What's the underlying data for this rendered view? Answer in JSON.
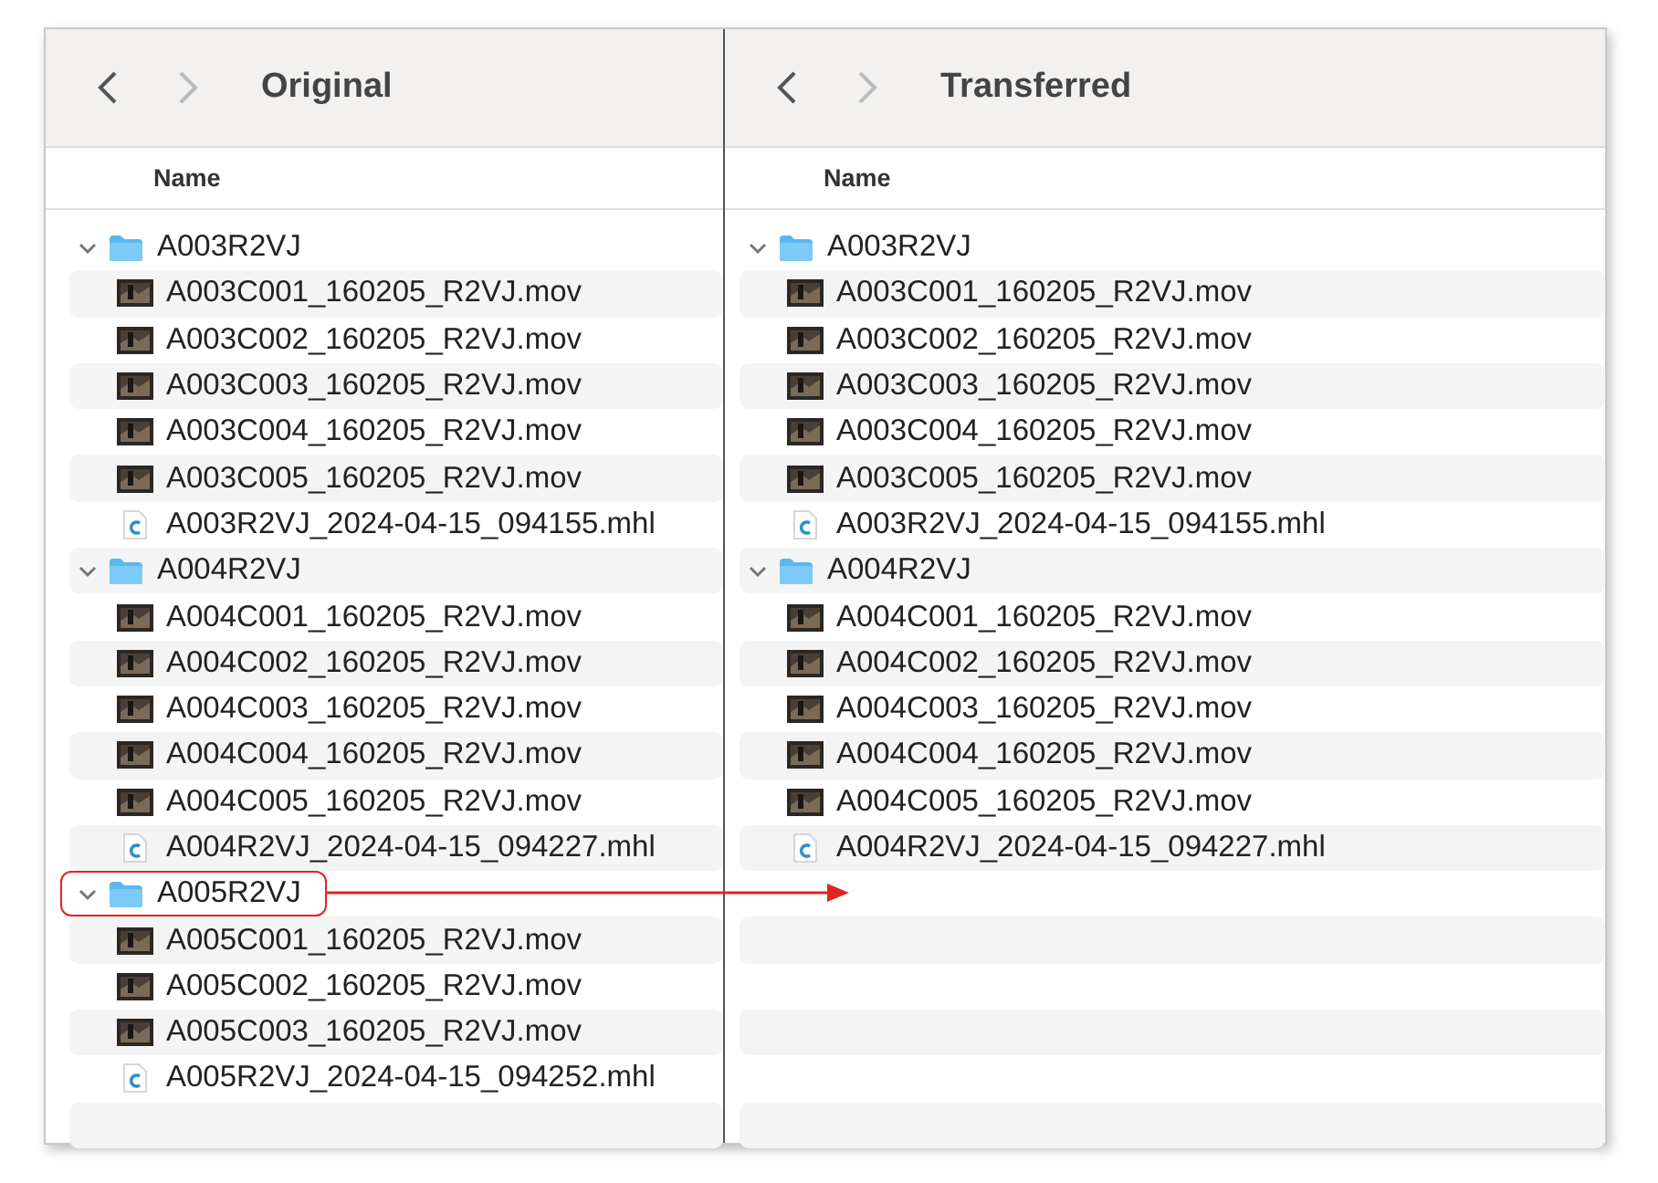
{
  "panes": [
    {
      "title": "Original",
      "back_enabled": true,
      "forward_enabled": false,
      "column_header": "Name",
      "items": [
        {
          "name": "A003R2VJ",
          "kind": "folder",
          "expanded": true,
          "children": [
            {
              "name": "A003C001_160205_R2VJ.mov",
              "kind": "video"
            },
            {
              "name": "A003C002_160205_R2VJ.mov",
              "kind": "video"
            },
            {
              "name": "A003C003_160205_R2VJ.mov",
              "kind": "video"
            },
            {
              "name": "A003C004_160205_R2VJ.mov",
              "kind": "video"
            },
            {
              "name": "A003C005_160205_R2VJ.mov",
              "kind": "video"
            },
            {
              "name": "A003R2VJ_2024-04-15_094155.mhl",
              "kind": "mhl"
            }
          ]
        },
        {
          "name": "A004R2VJ",
          "kind": "folder",
          "expanded": true,
          "children": [
            {
              "name": "A004C001_160205_R2VJ.mov",
              "kind": "video"
            },
            {
              "name": "A004C002_160205_R2VJ.mov",
              "kind": "video"
            },
            {
              "name": "A004C003_160205_R2VJ.mov",
              "kind": "video"
            },
            {
              "name": "A004C004_160205_R2VJ.mov",
              "kind": "video"
            },
            {
              "name": "A004C005_160205_R2VJ.mov",
              "kind": "video"
            },
            {
              "name": "A004R2VJ_2024-04-15_094227.mhl",
              "kind": "mhl"
            }
          ]
        },
        {
          "name": "A005R2VJ",
          "kind": "folder",
          "expanded": true,
          "highlighted": true,
          "children": [
            {
              "name": "A005C001_160205_R2VJ.mov",
              "kind": "video"
            },
            {
              "name": "A005C002_160205_R2VJ.mov",
              "kind": "video"
            },
            {
              "name": "A005C003_160205_R2VJ.mov",
              "kind": "video"
            },
            {
              "name": "A005R2VJ_2024-04-15_094252.mhl",
              "kind": "mhl"
            }
          ]
        }
      ]
    },
    {
      "title": "Transferred",
      "back_enabled": true,
      "forward_enabled": false,
      "column_header": "Name",
      "items": [
        {
          "name": "A003R2VJ",
          "kind": "folder",
          "expanded": true,
          "children": [
            {
              "name": "A003C001_160205_R2VJ.mov",
              "kind": "video"
            },
            {
              "name": "A003C002_160205_R2VJ.mov",
              "kind": "video"
            },
            {
              "name": "A003C003_160205_R2VJ.mov",
              "kind": "video"
            },
            {
              "name": "A003C004_160205_R2VJ.mov",
              "kind": "video"
            },
            {
              "name": "A003C005_160205_R2VJ.mov",
              "kind": "video"
            },
            {
              "name": "A003R2VJ_2024-04-15_094155.mhl",
              "kind": "mhl"
            }
          ]
        },
        {
          "name": "A004R2VJ",
          "kind": "folder",
          "expanded": true,
          "children": [
            {
              "name": "A004C001_160205_R2VJ.mov",
              "kind": "video"
            },
            {
              "name": "A004C002_160205_R2VJ.mov",
              "kind": "video"
            },
            {
              "name": "A004C003_160205_R2VJ.mov",
              "kind": "video"
            },
            {
              "name": "A004C004_160205_R2VJ.mov",
              "kind": "video"
            },
            {
              "name": "A004C005_160205_R2VJ.mov",
              "kind": "video"
            },
            {
              "name": "A004R2VJ_2024-04-15_094227.mhl",
              "kind": "mhl"
            }
          ]
        }
      ]
    }
  ]
}
